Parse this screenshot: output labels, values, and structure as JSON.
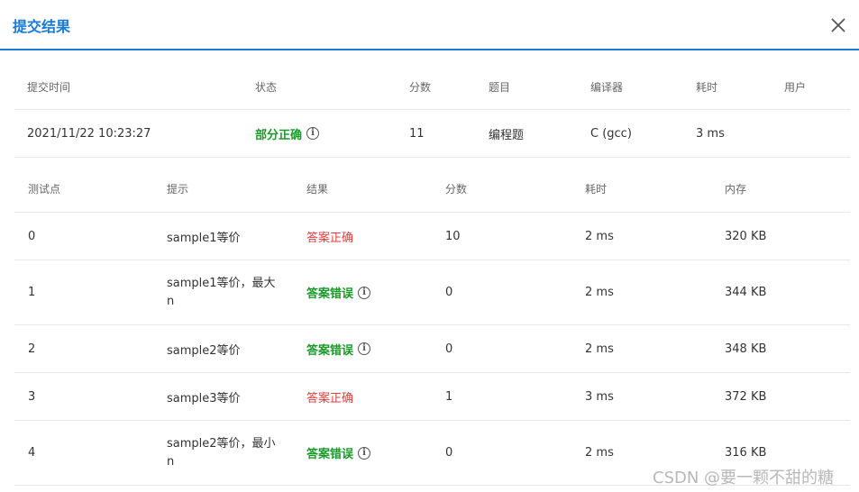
{
  "dialog": {
    "title": "提交结果"
  },
  "submission": {
    "headers": [
      "提交时间",
      "状态",
      "分数",
      "题目",
      "编译器",
      "耗时",
      "用户"
    ],
    "row": {
      "time": "2021/11/22 10:23:27",
      "status": "部分正确",
      "score": "11",
      "problem": "编程题",
      "compiler": "C (gcc)",
      "elapsed": "3 ms",
      "user": ""
    }
  },
  "tests": {
    "headers": [
      "测试点",
      "提示",
      "结果",
      "分数",
      "耗时",
      "内存"
    ],
    "rows": [
      {
        "id": "0",
        "hint": "sample1等价",
        "result": "答案正确",
        "score": "10",
        "time": "2 ms",
        "memory": "320 KB"
      },
      {
        "id": "1",
        "hint": "sample1等价，最大n",
        "result": "答案错误",
        "score": "0",
        "time": "2 ms",
        "memory": "344 KB"
      },
      {
        "id": "2",
        "hint": "sample2等价",
        "result": "答案错误",
        "score": "0",
        "time": "2 ms",
        "memory": "348 KB"
      },
      {
        "id": "3",
        "hint": "sample3等价",
        "result": "答案正确",
        "score": "1",
        "time": "3 ms",
        "memory": "372 KB"
      },
      {
        "id": "4",
        "hint": "sample2等价，最小n",
        "result": "答案错误",
        "score": "0",
        "time": "2 ms",
        "memory": "316 KB"
      }
    ]
  },
  "watermark": "CSDN @要一颗不甜的糖",
  "colors": {
    "accent": "#1a7ad6",
    "pass": "#e03c3c",
    "fail": "#1a9a29"
  },
  "icons": {
    "close": "close-icon",
    "info": "info-circle-icon"
  }
}
